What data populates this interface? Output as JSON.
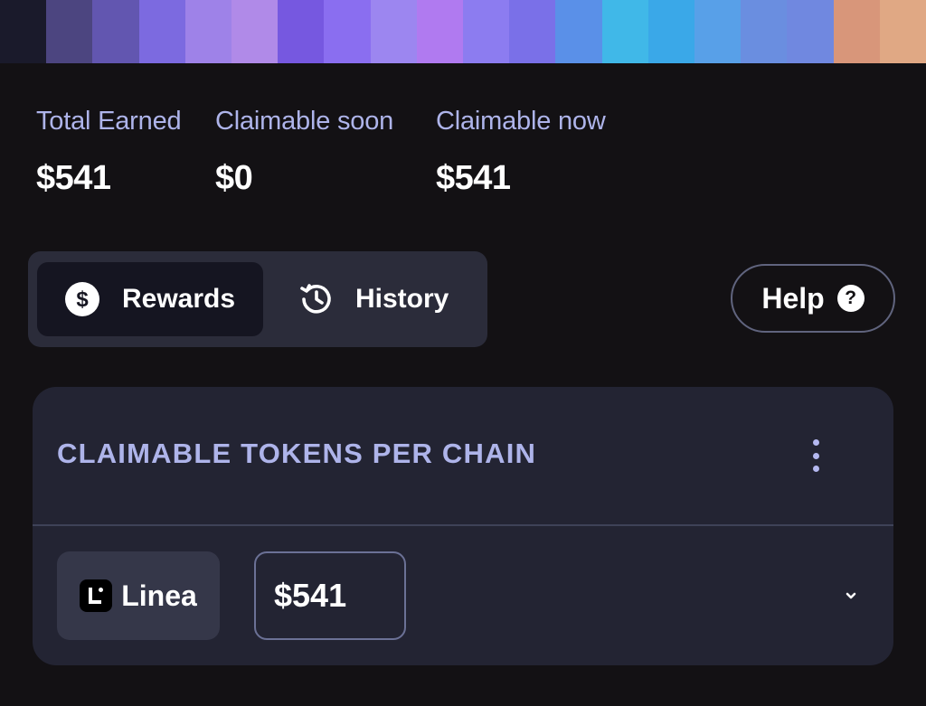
{
  "banner": {
    "colors": [
      "#1a1a2b",
      "#4c4580",
      "#6256b0",
      "#7c6ae0",
      "#9e82e8",
      "#b08ae8",
      "#7658e0",
      "#8a6ef0",
      "#9c86f0",
      "#b07af0",
      "#8c7cf0",
      "#7a70e8",
      "#5a90e8",
      "#40b8e8",
      "#3aa8e8",
      "#58a0e8",
      "#6a8ee0",
      "#7088e0",
      "#d8967a",
      "#e0a884"
    ]
  },
  "stats": [
    {
      "label": "Total Earned",
      "value": "$541"
    },
    {
      "label": "Claimable soon",
      "value": "$0"
    },
    {
      "label": "Claimable now",
      "value": "$541"
    }
  ],
  "tabs": {
    "rewards": {
      "label": "Rewards",
      "icon": "dollar-circle-icon"
    },
    "history": {
      "label": "History",
      "icon": "history-icon"
    }
  },
  "help": {
    "label": "Help",
    "icon": "question-circle-icon"
  },
  "card": {
    "title": "CLAIMABLE TOKENS PER CHAIN",
    "chain": {
      "name": "Linea",
      "icon": "linea-logo"
    },
    "amount": "$541"
  }
}
